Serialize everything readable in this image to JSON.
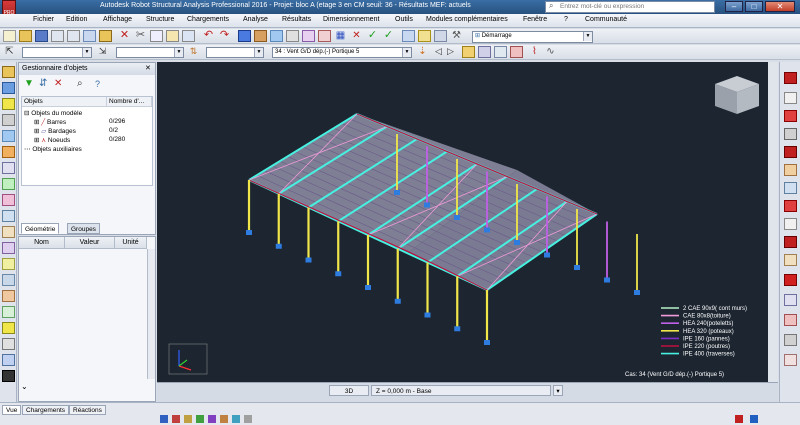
{
  "window": {
    "title": "Autodesk Robot Structural Analysis Professional 2016 - Projet: bloc A (etage 3 en CM seuil: 36 - Résultats MEF: actuels",
    "search_placeholder": "Entrez mot-clé ou expression",
    "logo_label": "PRO"
  },
  "menu": {
    "items": [
      "Fichier",
      "Edition",
      "Affichage",
      "Structure",
      "Chargements",
      "Analyse",
      "Résultats",
      "Dimensionnement",
      "Outils",
      "Modules complémentaires",
      "Fenêtre",
      "?"
    ],
    "community": "Communauté"
  },
  "toolbar2": {
    "layout_combo": "Démarrage",
    "case_combo": "34 : Vent G/D dép.(-) Portique 5"
  },
  "object_manager": {
    "title": "Gestionnaire d'objets",
    "columns": [
      "Objets",
      "Nombre d'..."
    ],
    "tree": [
      {
        "label": "Objets du modèle",
        "count": ""
      },
      {
        "label": "Barres",
        "count": "0/296"
      },
      {
        "label": "Bardages",
        "count": "0/2"
      },
      {
        "label": "Noeuds",
        "count": "0/280"
      },
      {
        "label": "Objets auxiliaires",
        "count": ""
      }
    ],
    "tabs": [
      "Géométrie",
      "Groupes"
    ]
  },
  "properties": {
    "columns": [
      "Nom",
      "Valeur",
      "Unité"
    ]
  },
  "viewport": {
    "legend": [
      {
        "label": "2 CAE 90x9( cont murs)",
        "color": "#b5f2c9"
      },
      {
        "label": "CAE 80x8(toiture)",
        "color": "#f09ad8"
      },
      {
        "label": "HEA 240(poteletts)",
        "color": "#c060e8"
      },
      {
        "label": "HEA 320 (poteaux)",
        "color": "#f0e64a"
      },
      {
        "label": "IPE 160 (pannes)",
        "color": "#7e2fc8"
      },
      {
        "label": "IPE 220 (poutres)",
        "color": "#c01040"
      },
      {
        "label": "IPE 400 (traverses)",
        "color": "#47f0e0"
      }
    ],
    "case_label": "Cas: 34 (Vent G/D dép.(-) Portique 5)",
    "view_mode": "3D",
    "level": "Z = 0,000 m - Base"
  },
  "status_tabs": [
    "Vue",
    "Chargements",
    "Réactions"
  ],
  "colors": {
    "viewport_bg": "#1c2530",
    "roof_fill": "#8f8fa6",
    "bracing": "#f09ad8",
    "rafters": "#47f0e0",
    "columns": "#f0e64a",
    "posts": "#c060e8",
    "supports": "#2f7ce0"
  }
}
